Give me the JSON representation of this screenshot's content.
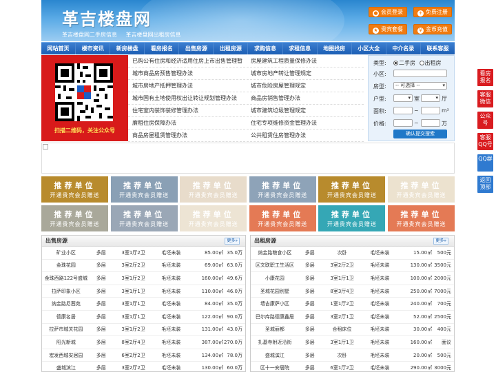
{
  "header": {
    "title": "革吉楼盘网",
    "sublinks": [
      "革吉楼盘网二手房信息",
      "革吉楼盘网出租房信息"
    ],
    "buttons": [
      "会员登录",
      "免费注册",
      "贵宾套餐",
      "金币充值"
    ]
  },
  "nav": [
    "网站首页",
    "楼市资讯",
    "新房楼盘",
    "看房报名",
    "出售房源",
    "出租房源",
    "求购信息",
    "求租信息",
    "地图找房",
    "小区大全",
    "中介名录",
    "联系客服"
  ],
  "qr": {
    "caption": "扫描二维码，关注公众号"
  },
  "links_left": [
    "已购公有住房和经济适用住房上市出售管理暂",
    "城市商品房预售管理办法",
    "城市房地产抵押管理办法",
    "城市国有土地使用权出让转让规划管理办法",
    "住宅室内装饰装修管理办法",
    "廉租住房保障办法",
    "商品房屋租赁管理办法"
  ],
  "links_right": [
    "房屋建筑工程质量保修办法",
    "城市房地产转让管理规定",
    "城市危险房屋管理规定",
    "商品房销售管理办法",
    "城市建筑垃圾管理规定",
    "住宅专项维修资金管理办法",
    "公共租赁住房管理办法"
  ],
  "search": {
    "type_label": "类型:",
    "type_options": [
      "二手房",
      "出租房"
    ],
    "community_label": "小区:",
    "housetype_label": "房型:",
    "housetype_value": "-- 可选择 --",
    "layout_label": "户型:",
    "room_unit": "室",
    "hall_unit": "厅",
    "area_label": "面积:",
    "area_unit": "m²",
    "price_label": "价格:",
    "price_unit": "万",
    "range_sep": "~",
    "submit": "确认提交搜索"
  },
  "tiles": {
    "line1": "推荐单位",
    "line2": "开通贵宾会员赠送",
    "colors_row1": [
      "#b88b2d",
      "#8aa0b5",
      "#e8dccb",
      "#8ea3b8",
      "#b88b2d",
      "#ece2cf"
    ],
    "colors_row2": [
      "#a9a89a",
      "#9aa7b6",
      "#ede4d4",
      "#e47a55",
      "#35a7b5",
      "#e47a55"
    ]
  },
  "sale": {
    "title": "出售房源",
    "more": "更多",
    "rows": [
      [
        "矿业小区",
        "多层",
        "3室1厅2卫",
        "毛坯未装",
        "85.00㎡",
        "35.0万"
      ],
      [
        "金珠花园",
        "多层",
        "3室2厅2卫",
        "毛坯未装",
        "69.00㎡",
        "63.0万"
      ],
      [
        "金珠西路122号盛城",
        "多层",
        "3室1厅2卫",
        "毛坯未装",
        "160.00㎡",
        "49.6万"
      ],
      [
        "拉萨印象小区",
        "多层",
        "3室1厅1卫",
        "毛坯未装",
        "110.00㎡",
        "46.0万"
      ],
      [
        "纳金路尼茜苑",
        "多层",
        "3室1厅1卫",
        "毛坯未装",
        "84.00㎡",
        "35.0万"
      ],
      [
        "德康名居",
        "多层",
        "3室1厅1卫",
        "毛坯未装",
        "122.00㎡",
        "90.0万"
      ],
      [
        "拉萨市城关花园",
        "多层",
        "3室1厅2卫",
        "毛坯未装",
        "131.00㎡",
        "43.0万"
      ],
      [
        "阳光新城",
        "多层",
        "8室2厅4卫",
        "毛坯未装",
        "387.00㎡",
        "270.0万"
      ],
      [
        "宏发西城安居园",
        "多层",
        "6室2厅2卫",
        "毛坯未装",
        "134.00㎡",
        "78.0万"
      ],
      [
        "盛城滨江",
        "多层",
        "3室2厅2卫",
        "毛坯未装",
        "130.00㎡",
        "60.0万"
      ]
    ]
  },
  "rent": {
    "title": "出租房源",
    "more": "更多",
    "rows": [
      [
        "纳金路粮食小区",
        "多层",
        "次卧",
        "毛坯未装",
        "15.00㎡",
        "500元"
      ],
      [
        "区文联职工生活区",
        "多层",
        "3室2厅2卫",
        "毛坯未装",
        "130.00㎡",
        "3500元"
      ],
      [
        "小康花园",
        "多层",
        "3室1厅1卫",
        "毛坯未装",
        "100.00㎡",
        "2000元"
      ],
      [
        "圣城花园别墅",
        "多层",
        "8室3厅4卫",
        "毛坯未装",
        "250.00㎡",
        "7000元"
      ],
      [
        "墙吉康萨小区",
        "多层",
        "1室1厅2卫",
        "毛坯未装",
        "240.00㎡",
        "700元"
      ],
      [
        "巴尔库路德康鑫居",
        "多层",
        "3室2厅1卫",
        "毛坯未装",
        "52.00㎡",
        "2500元"
      ],
      [
        "圣城丽都",
        "多层",
        "合租床位",
        "毛坯未装",
        "30.00㎡",
        "400元"
      ],
      [
        "扎基寺附近沿街",
        "多层",
        "3室1厅1卫",
        "毛坯未装",
        "160.00㎡",
        "面议"
      ],
      [
        "盛城滨江",
        "多层",
        "次卧",
        "毛坯未装",
        "20.00㎡",
        "500元"
      ],
      [
        "区十一安居院",
        "多层",
        "6室1厅2卫",
        "毛坯未装",
        "290.00㎡",
        "3000元"
      ]
    ]
  },
  "side": [
    "看房报名",
    "客服微信",
    "公众号",
    "客服QQ号",
    "QQ群",
    "返回顶部"
  ]
}
